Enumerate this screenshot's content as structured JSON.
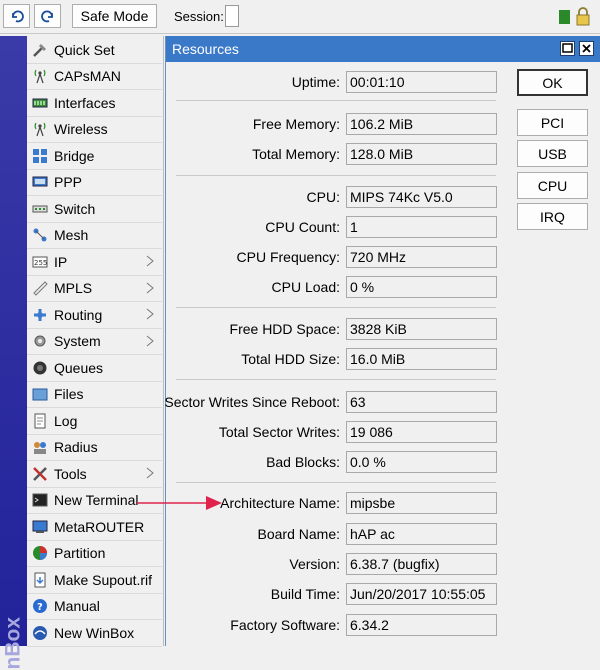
{
  "toolbar": {
    "safe_mode_label": "Safe Mode",
    "session_label": "Session:"
  },
  "sidebar": {
    "brand_text": "nBox",
    "items": [
      {
        "label": "Quick Set",
        "icon": "quick-set-icon",
        "submenu": false
      },
      {
        "label": "CAPsMAN",
        "icon": "antenna-icon",
        "submenu": false
      },
      {
        "label": "Interfaces",
        "icon": "interfaces-icon",
        "submenu": false
      },
      {
        "label": "Wireless",
        "icon": "wireless-icon",
        "submenu": false
      },
      {
        "label": "Bridge",
        "icon": "bridge-icon",
        "submenu": false
      },
      {
        "label": "PPP",
        "icon": "ppp-icon",
        "submenu": false
      },
      {
        "label": "Switch",
        "icon": "switch-icon",
        "submenu": false
      },
      {
        "label": "Mesh",
        "icon": "mesh-icon",
        "submenu": false
      },
      {
        "label": "IP",
        "icon": "ip-icon",
        "submenu": true
      },
      {
        "label": "MPLS",
        "icon": "mpls-icon",
        "submenu": true
      },
      {
        "label": "Routing",
        "icon": "routing-icon",
        "submenu": true
      },
      {
        "label": "System",
        "icon": "gear-icon",
        "submenu": true
      },
      {
        "label": "Queues",
        "icon": "queues-icon",
        "submenu": false
      },
      {
        "label": "Files",
        "icon": "folder-icon",
        "submenu": false
      },
      {
        "label": "Log",
        "icon": "log-icon",
        "submenu": false
      },
      {
        "label": "Radius",
        "icon": "radius-icon",
        "submenu": false
      },
      {
        "label": "Tools",
        "icon": "tools-icon",
        "submenu": true
      },
      {
        "label": "New Terminal",
        "icon": "terminal-icon",
        "submenu": false
      },
      {
        "label": "MetaROUTER",
        "icon": "metarouter-icon",
        "submenu": false
      },
      {
        "label": "Partition",
        "icon": "partition-icon",
        "submenu": false
      },
      {
        "label": "Make Supout.rif",
        "icon": "supout-icon",
        "submenu": false
      },
      {
        "label": "Manual",
        "icon": "help-icon",
        "submenu": false
      },
      {
        "label": "New WinBox",
        "icon": "winbox-icon",
        "submenu": false
      }
    ]
  },
  "resources": {
    "title": "Resources",
    "fields": {
      "uptime": {
        "label": "Uptime:",
        "value": "00:01:10"
      },
      "free_memory": {
        "label": "Free Memory:",
        "value": "106.2 MiB"
      },
      "total_memory": {
        "label": "Total Memory:",
        "value": "128.0 MiB"
      },
      "cpu": {
        "label": "CPU:",
        "value": "MIPS 74Kc V5.0"
      },
      "cpu_count": {
        "label": "CPU Count:",
        "value": "1"
      },
      "cpu_frequency": {
        "label": "CPU Frequency:",
        "value": "720 MHz"
      },
      "cpu_load": {
        "label": "CPU Load:",
        "value": "0 %"
      },
      "free_hdd": {
        "label": "Free HDD Space:",
        "value": "3828 KiB"
      },
      "total_hdd": {
        "label": "Total HDD Size:",
        "value": "16.0 MiB"
      },
      "sector_writes_since_reboot": {
        "label": "Sector Writes Since Reboot:",
        "value": "63"
      },
      "total_sector_writes": {
        "label": "Total Sector Writes:",
        "value": "19 086"
      },
      "bad_blocks": {
        "label": "Bad Blocks:",
        "value": "0.0 %"
      },
      "architecture_name": {
        "label": "Architecture Name:",
        "value": "mipsbe"
      },
      "board_name": {
        "label": "Board Name:",
        "value": "hAP ac"
      },
      "version": {
        "label": "Version:",
        "value": "6.38.7 (bugfix)"
      },
      "build_time": {
        "label": "Build Time:",
        "value": "Jun/20/2017 10:55:05"
      },
      "factory_software": {
        "label": "Factory Software:",
        "value": "6.34.2"
      }
    },
    "buttons": {
      "ok": "OK",
      "pci": "PCI",
      "usb": "USB",
      "cpu": "CPU",
      "irq": "IRQ"
    }
  },
  "colors": {
    "title_bar": "#3a78c8",
    "sidebar_strip": "#2a2aa0",
    "annotation_arrow": "#e0234d"
  }
}
